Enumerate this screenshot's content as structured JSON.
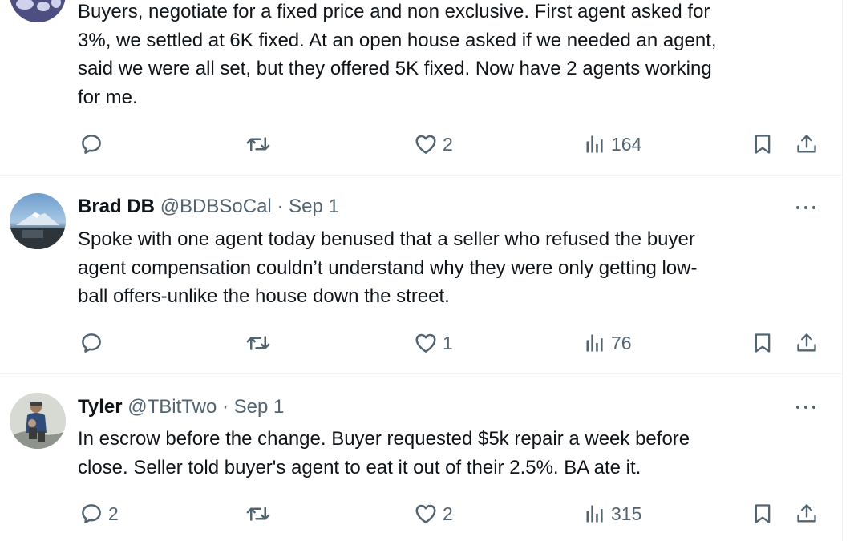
{
  "tweets": [
    {
      "name": "",
      "handle": "",
      "date": "",
      "lines": [
        "Buyers, negotiate for a fixed price and non exclusive. First agent asked for",
        "3%, we settled at 6K fixed. At an open house asked if we needed an agent,",
        "said we were all set, but they offered 5K fixed. Now have 2 agents working",
        "for me."
      ],
      "replies": "",
      "retweets": "",
      "likes": "2",
      "views": "164"
    },
    {
      "name": "Brad DB",
      "handle": "@BDBSoCal",
      "date": "Sep 1",
      "lines": [
        "Spoke with one agent today benused that a seller who refused the buyer",
        "agent compensation couldn’t understand why they were only getting low-",
        "ball offers-unlike the house down the street."
      ],
      "replies": "",
      "retweets": "",
      "likes": "1",
      "views": "76"
    },
    {
      "name": "Tyler",
      "handle": "@TBitTwo",
      "date": "Sep 1",
      "lines": [
        "In escrow before the change. Buyer requested $5k repair a week before",
        "close. Seller told buyer's agent to eat it out of their 2.5%. BA ate it."
      ],
      "replies": "2",
      "retweets": "",
      "likes": "2",
      "views": "315"
    }
  ],
  "separator": "·",
  "icons": [
    "reply-icon",
    "retweet-icon",
    "like-icon",
    "views-icon",
    "bookmark-icon",
    "share-icon",
    "more-icon"
  ],
  "colors": {
    "text": "#0f1419",
    "secondary": "#536471",
    "divider": "#eff3f4"
  }
}
